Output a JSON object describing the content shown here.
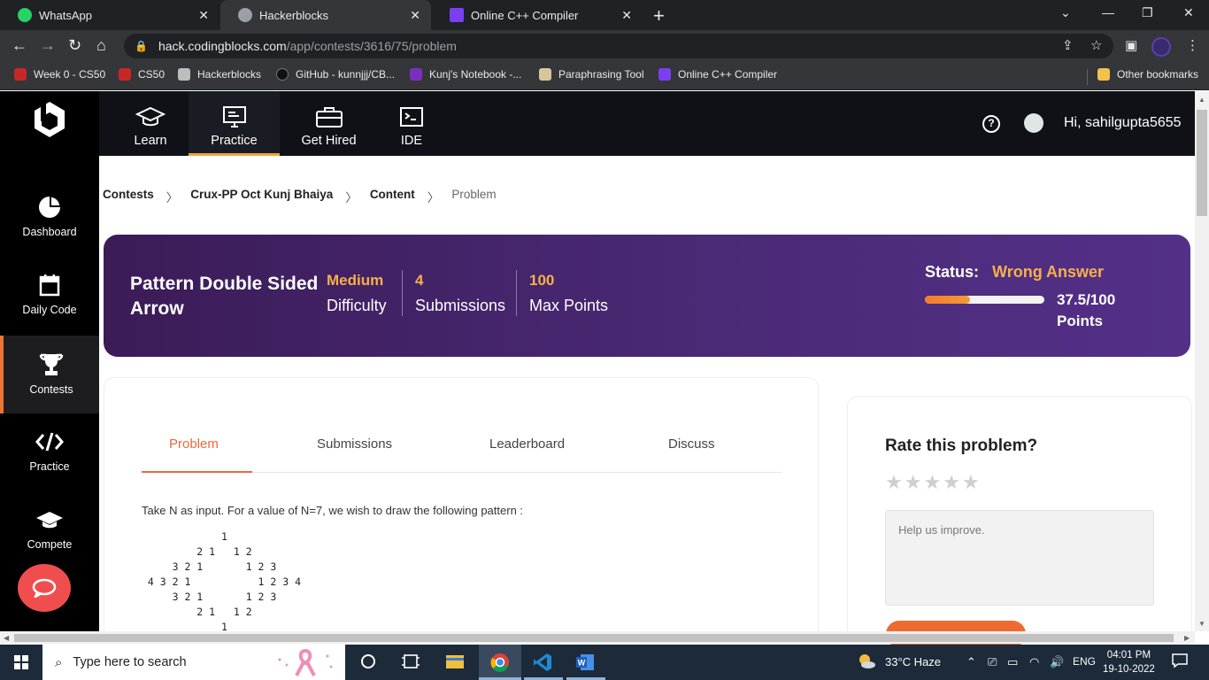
{
  "browser": {
    "tabs": [
      {
        "title": "WhatsApp",
        "color": "#25d366"
      },
      {
        "title": "Hackerblocks",
        "color": "#9aa0a6"
      },
      {
        "title": "Online C++ Compiler",
        "color": "#7b3ff2"
      }
    ],
    "url_host": "hack.codingblocks.com",
    "url_path": "/app/contests/3616/75/problem",
    "bookmarks": [
      "Week 0 - CS50",
      "CS50",
      "Hackerblocks",
      "GitHub - kunnjjj/CB...",
      "Kunj's Notebook -...",
      "Paraphrasing Tool",
      "Online C++ Compiler"
    ],
    "other_bookmarks": "Other bookmarks"
  },
  "sidebar": {
    "items": [
      {
        "label": "Dashboard",
        "icon": "pie-chart-icon"
      },
      {
        "label": "Daily Code",
        "icon": "calendar-icon"
      },
      {
        "label": "Contests",
        "icon": "trophy-icon"
      },
      {
        "label": "Practice",
        "icon": "code-icon"
      },
      {
        "label": "Compete",
        "icon": "graduation-cap-icon"
      }
    ],
    "active": "Contests"
  },
  "topnav": {
    "items": [
      {
        "label": "Learn",
        "icon": "graduation-cap-icon"
      },
      {
        "label": "Practice",
        "icon": "monitor-icon"
      },
      {
        "label": "Get Hired",
        "icon": "briefcase-icon"
      },
      {
        "label": "IDE",
        "icon": "terminal-icon"
      }
    ],
    "active": "Practice",
    "help": "?",
    "greeting": "Hi, sahilgupta5655"
  },
  "breadcrumb": {
    "items": [
      "Contests",
      "Crux-PP Oct Kunj Bhaiya",
      "Content",
      "Problem"
    ],
    "separator": "〉"
  },
  "problem": {
    "title": "Pattern Double Sided Arrow",
    "difficulty_value": "Medium",
    "difficulty_label": "Difficulty",
    "submissions_value": "4",
    "submissions_label": "Submissions",
    "points_value": "100",
    "points_label": "Max Points",
    "status_label": "Status:",
    "status_value": "Wrong Answer",
    "score": "37.5/100",
    "score_label": "Points",
    "progress": 0.375
  },
  "content": {
    "tabs": [
      "Problem",
      "Submissions",
      "Leaderboard",
      "Discuss"
    ],
    "active_tab": "Problem",
    "description": "Take N as input. For a value of N=7, we wish to draw the following pattern :",
    "pattern": "             1\n         2 1   1 2\n     3 2 1       1 2 3\n 4 3 2 1           1 2 3 4\n     3 2 1       1 2 3\n         2 1   1 2\n             1"
  },
  "rating": {
    "title": "Rate this problem?",
    "stars": 5,
    "filled": 0,
    "placeholder": "Help us improve."
  },
  "taskbar": {
    "search_placeholder": "Type here to search",
    "weather": "33°C  Haze",
    "lang": "ENG",
    "time": "04:01 PM",
    "date": "19-10-2022"
  },
  "colors": {
    "accent": "#ee7432",
    "status": "#f6b04a",
    "banner": "#4b2a78"
  }
}
